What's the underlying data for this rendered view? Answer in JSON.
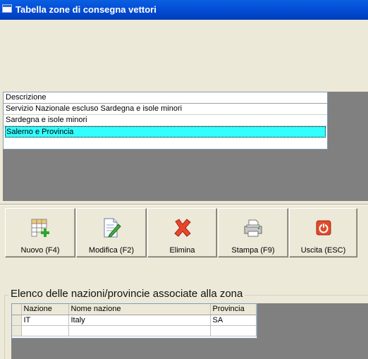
{
  "window": {
    "title": "Tabella zone di consegna vettori"
  },
  "zone_list": {
    "header": "Descrizione",
    "rows": [
      "Servizio Nazionale escluso Sardegna e isole minori",
      "Sardegna e isole minori",
      "Salerno e Provincia"
    ],
    "selected_index": 2
  },
  "toolbar": {
    "new_label": "Nuovo (F4)",
    "edit_label": "Modifica (F2)",
    "delete_label": "Elimina",
    "print_label": "Stampa (F9)",
    "exit_label": "Uscita (ESC)"
  },
  "associations": {
    "title": "Elenco delle nazioni/provincie associate alla zona",
    "columns": [
      "Nazione",
      "Nome nazione",
      "Provincia"
    ],
    "rows": [
      {
        "nazione": "IT",
        "nome_nazione": "Italy",
        "provincia": "SA"
      }
    ]
  },
  "colors": {
    "title_bar": "#0450D8",
    "selection": "#33FFFF",
    "panel_bg": "#808080",
    "window_bg": "#ECE9D8"
  }
}
